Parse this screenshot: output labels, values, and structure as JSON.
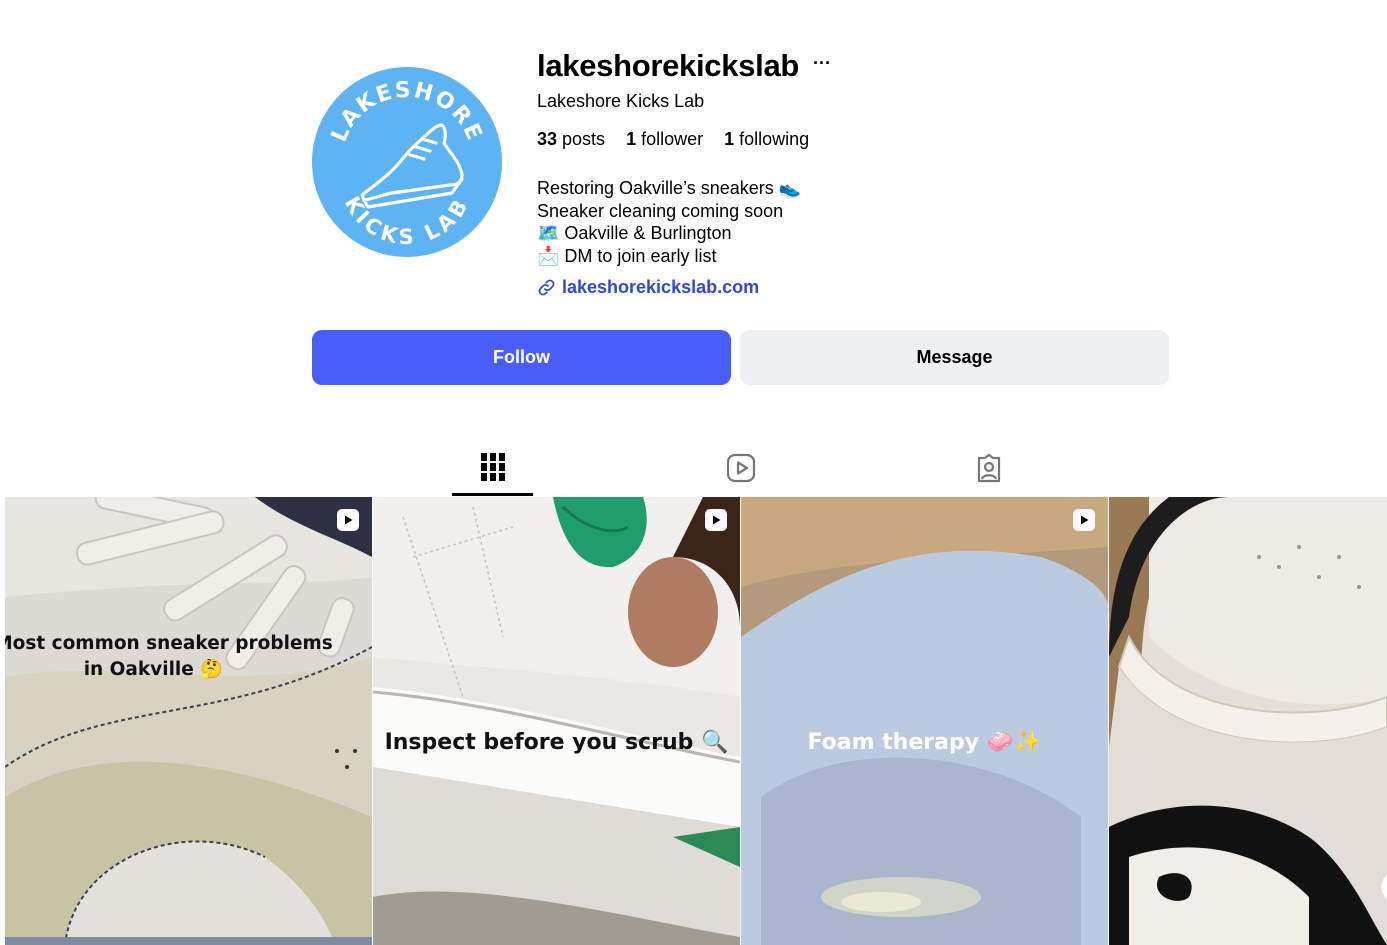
{
  "profile": {
    "username": "lakeshorekickslab",
    "more_label": "···",
    "full_name": "Lakeshore Kicks Lab",
    "avatar_text_top": "LAKESHORE",
    "avatar_text_bottom": "KICKS LAB",
    "stats": {
      "posts_count": "33",
      "posts_label": "posts",
      "followers_count": "1",
      "followers_label": "follower",
      "following_count": "1",
      "following_label": "following"
    },
    "bio": [
      "Restoring Oakville’s sneakers 👟",
      "Sneaker cleaning coming soon",
      "🗺️ Oakville & Burlington",
      "📩 DM to join early list"
    ],
    "link_text": "lakeshorekickslab.com"
  },
  "actions": {
    "follow_label": "Follow",
    "message_label": "Message"
  },
  "tabs": [
    {
      "name": "posts",
      "icon": "grid-icon",
      "active": true
    },
    {
      "name": "reels",
      "icon": "reels-icon",
      "active": false
    },
    {
      "name": "tagged",
      "icon": "tagged-icon",
      "active": false
    }
  ],
  "posts": [
    {
      "type": "reel",
      "caption_line1": "Most common sneaker problems",
      "caption_line2": "in Oakville 🤔"
    },
    {
      "type": "reel",
      "caption_line1": "Inspect before you scrub 🔍"
    },
    {
      "type": "reel",
      "caption_line1": "Foam therapy 🧼✨"
    },
    {
      "type": "image",
      "caption_line1": ""
    }
  ],
  "colors": {
    "follow_button": "#4a5df9",
    "message_button": "#eff0f3",
    "link": "#3545d6",
    "avatar_bg": "#5eb3f2"
  }
}
